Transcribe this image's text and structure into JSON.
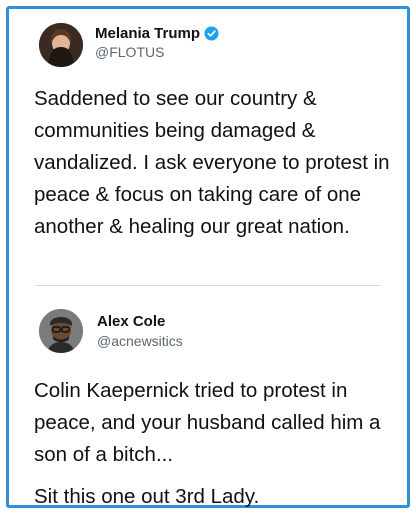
{
  "tweets": [
    {
      "name": "Melania Trump",
      "handle": "@FLOTUS",
      "verified": true,
      "text": "Saddened to see our country & communities being damaged & vandalized. I ask everyone to protest in peace & focus on taking care of one another & healing our great nation."
    },
    {
      "name": "Alex Cole",
      "handle": "@acnewsitics",
      "verified": false,
      "paragraphs": [
        "Colin Kaepernick tried to protest in peace, and your husband called him a son of a bitch...",
        "Sit this one out 3rd Lady."
      ]
    }
  ],
  "colors": {
    "frame_border": "#2f8fd8",
    "verified_badge": "#1da1f2",
    "handle_text": "#5b6772"
  },
  "icons": {
    "verified": "verified-badge-icon",
    "avatar": "profile-photo"
  }
}
